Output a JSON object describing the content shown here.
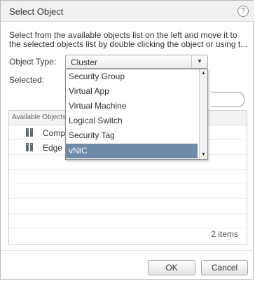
{
  "dialog": {
    "title": "Select Object",
    "help_glyph": "?",
    "description_line1": "Select from the available objects list on the left and move it to",
    "description_line2": "the selected objects list by double clicking the object or using t..."
  },
  "form": {
    "object_type_label": "Object Type:",
    "object_type_value": "Cluster",
    "selected_label": "Selected:"
  },
  "dropdown": {
    "options": [
      "Security Group",
      "Virtual App",
      "Virtual Machine",
      "Logical Switch",
      "Security Tag",
      "vNIC"
    ],
    "highlighted": "vNIC"
  },
  "available": {
    "header": "Available Objects",
    "rows": [
      "Comp",
      "Edge"
    ],
    "count_text": "2 items"
  },
  "buttons": {
    "ok": "OK",
    "cancel": "Cancel"
  },
  "colors": {
    "highlight": "#6f8aa8",
    "title_bar": "#f1f1f1"
  }
}
